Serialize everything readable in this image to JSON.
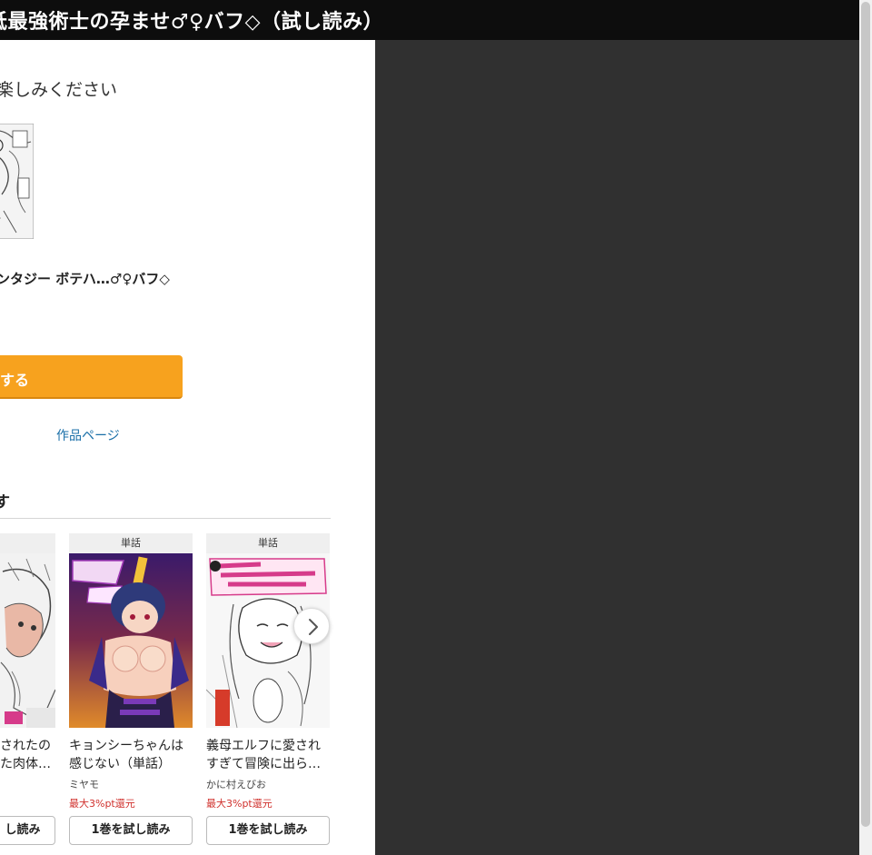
{
  "header": {
    "title": "抵最強術士の孕ませ♂♀バフ◇（試し読み）"
  },
  "intro": {
    "text": "楽しみください"
  },
  "work": {
    "title": "ンタジー ボテハ…♂♀バフ◇"
  },
  "cta": {
    "label": "する"
  },
  "links": {
    "work_page": "作品ページ"
  },
  "recommend": {
    "heading": "す",
    "cards": [
      {
        "badge": "",
        "title": "されたの\nた肉体…",
        "author": "",
        "point": "",
        "button": "し読み"
      },
      {
        "badge": "単話",
        "title": "キョンシーちゃんは\n感じない（単話）",
        "author": "ミヤモ",
        "point": "最大3%pt還元",
        "button": "1巻を試し読み"
      },
      {
        "badge": "単話",
        "title": "義母エルフに愛され\nすぎて冒険に出ら…",
        "author": "かに村えびお",
        "point": "最大3%pt還元",
        "button": "1巻を試し読み"
      }
    ]
  },
  "icons": {
    "next": "chevron-right-icon"
  },
  "colors": {
    "header_bg": "#0d0d0d",
    "cta": "#f7a21e",
    "link": "#1a6fa8",
    "point": "#d0312d",
    "viewer_bg": "#303030"
  }
}
